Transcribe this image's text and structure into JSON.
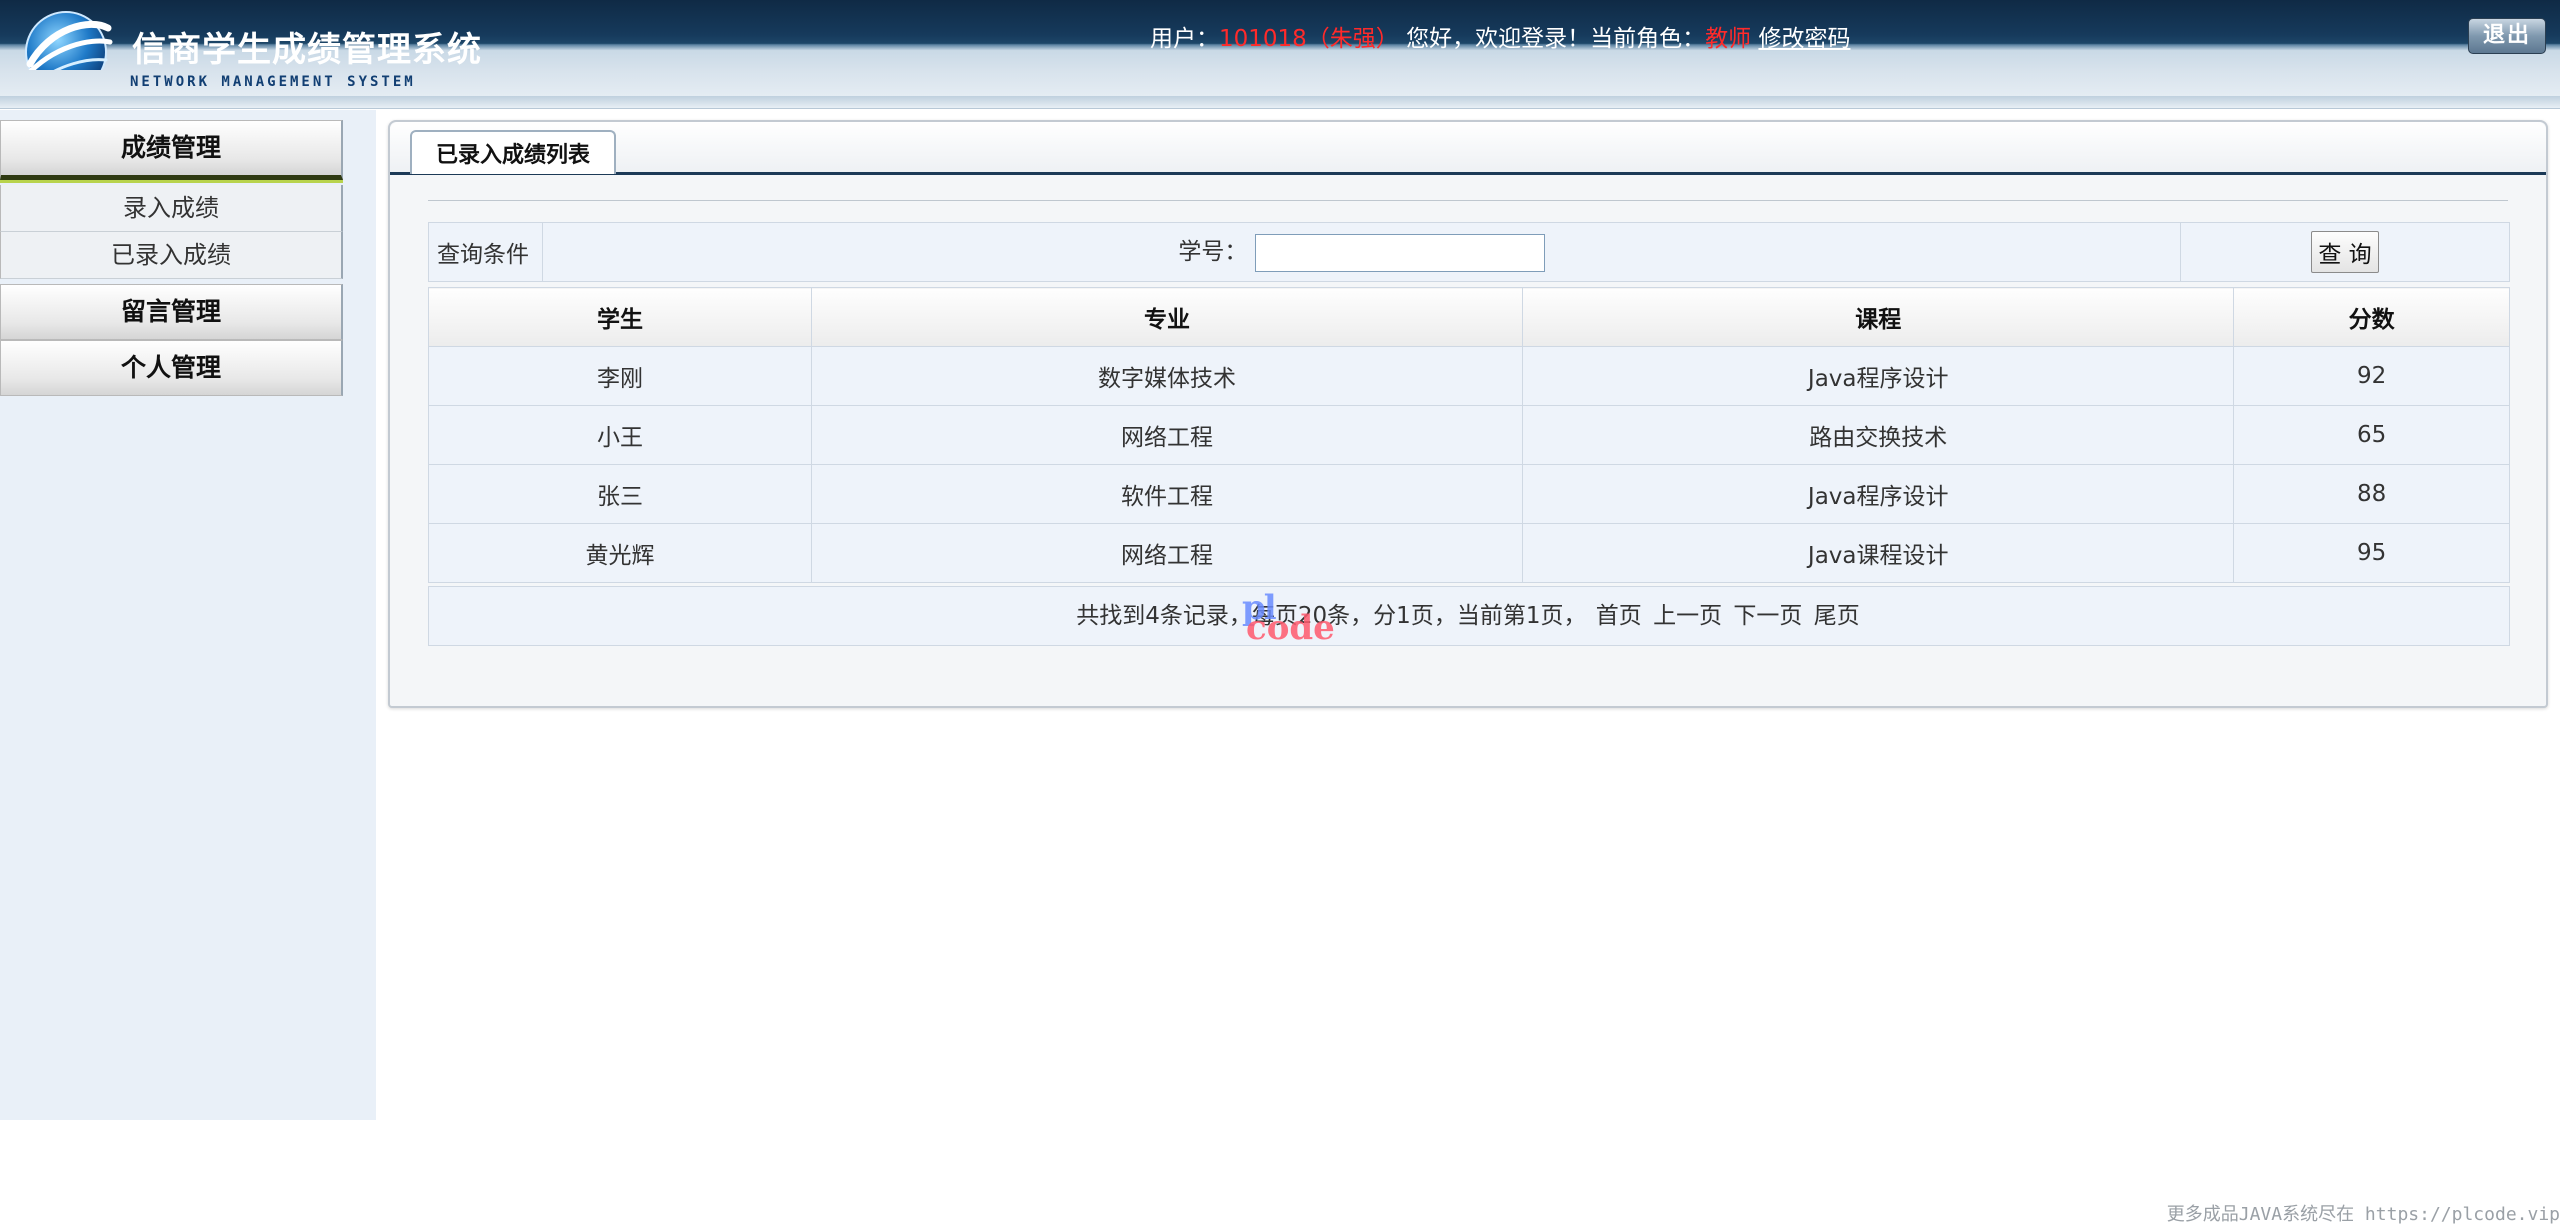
{
  "header": {
    "app_title": "信商学生成绩管理系统",
    "app_subtitle": "NETWORK MANAGEMENT SYSTEM",
    "user_label": "用户：",
    "user_value": "101018（朱强）",
    "welcome_text": "您好，欢迎登录！当前角色：",
    "role_value": "教师",
    "change_password_link": "修改密码",
    "logout_button": "退出"
  },
  "sidebar": {
    "sections": [
      {
        "label": "成绩管理"
      },
      {
        "label": "留言管理"
      },
      {
        "label": "个人管理"
      }
    ],
    "items": [
      {
        "label": "录入成绩"
      },
      {
        "label": "已录入成绩"
      }
    ]
  },
  "main": {
    "tab_label": "已录入成绩列表",
    "query": {
      "condition_label": "查询条件",
      "student_id_label": "学号：",
      "student_id_value": "",
      "search_button": "查 询"
    },
    "table": {
      "headers": [
        "学生",
        "专业",
        "课程",
        "分数"
      ],
      "rows": [
        [
          "李刚",
          "数字媒体技术",
          "Java程序设计",
          "92"
        ],
        [
          "小王",
          "网络工程",
          "路由交换技术",
          "65"
        ],
        [
          "张三",
          "软件工程",
          "Java程序设计",
          "88"
        ],
        [
          "黄光辉",
          "网络工程",
          "Java课程设计",
          "95"
        ]
      ]
    },
    "pager": {
      "summary": "共找到4条记录，每页20条，分1页，当前第1页，",
      "first": "首页",
      "prev": "上一页",
      "next": "下一页",
      "last": "尾页"
    }
  },
  "watermark": {
    "line1": "pl",
    "line2": "code"
  },
  "footer_note": "更多成品JAVA系统尽在 https://plcode.vip"
}
